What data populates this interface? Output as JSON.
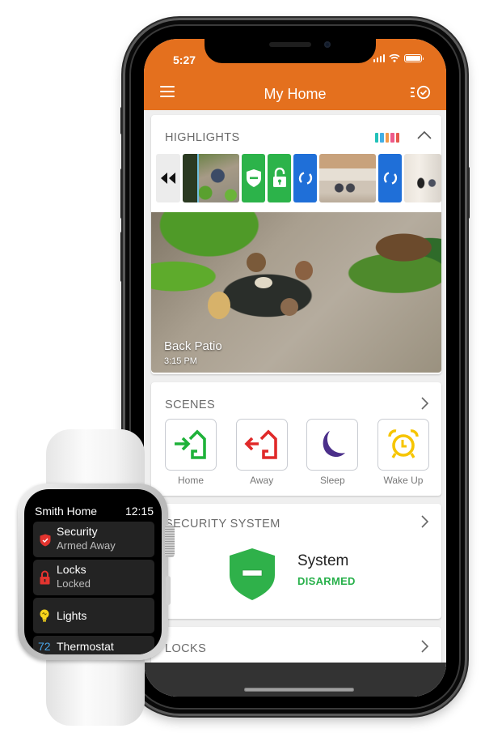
{
  "phone": {
    "status_bar": {
      "time": "5:27"
    },
    "app_bar": {
      "title": "My Home",
      "menu_icon": "hamburger-menu-icon",
      "tasks_icon": "checklist-icon"
    },
    "highlights": {
      "title": "HIGHLIGHTS",
      "legend_colors": [
        "#22c1b8",
        "#42aee6",
        "#f29a4a",
        "#ee5a8a",
        "#e6574c"
      ],
      "tiles": [
        {
          "type": "rewind",
          "icon": "rewind-icon"
        },
        {
          "type": "photo",
          "subject": "back-patio"
        },
        {
          "type": "event",
          "icon": "shield-disarmed-icon",
          "color": "#2cb34a"
        },
        {
          "type": "event",
          "icon": "unlocked-icon",
          "color": "#2cb34a"
        },
        {
          "type": "event",
          "icon": "refresh-icon",
          "color": "#1f6fd8"
        },
        {
          "type": "photo",
          "subject": "living-room"
        },
        {
          "type": "event",
          "icon": "refresh-icon",
          "color": "#1f6fd8"
        },
        {
          "type": "photo",
          "subject": "front-door"
        }
      ],
      "camera": {
        "label": "Back Patio",
        "time": "3:15 PM"
      }
    },
    "scenes": {
      "title": "SCENES",
      "items": [
        {
          "label": "Home",
          "icon": "arrive-home-icon",
          "color": "#1fb23a"
        },
        {
          "label": "Away",
          "icon": "leave-home-icon",
          "color": "#e02a2a"
        },
        {
          "label": "Sleep",
          "icon": "moon-icon",
          "color": "#4b2f8a"
        },
        {
          "label": "Wake Up",
          "icon": "alarm-clock-icon",
          "color": "#f6c500"
        }
      ]
    },
    "security": {
      "title": "SECURITY SYSTEM",
      "device_name": "System",
      "state": "DISARMED",
      "state_color": "#27b04a"
    },
    "locks": {
      "title": "LOCKS"
    },
    "colors": {
      "accent": "#e4701e"
    }
  },
  "watch": {
    "title": "Smith Home",
    "time": "12:15",
    "items": [
      {
        "label": "Security",
        "sub": "Armed Away",
        "icon": "shield-check-icon",
        "color": "#e3342f"
      },
      {
        "label": "Locks",
        "sub": "Locked",
        "icon": "lock-icon",
        "color": "#e3342f"
      },
      {
        "label": "Lights",
        "sub": "",
        "icon": "lightbulb-icon",
        "color": "#f7d51c"
      },
      {
        "label": "Thermostat",
        "value": "72",
        "value_color": "#4aa5e8"
      }
    ]
  }
}
